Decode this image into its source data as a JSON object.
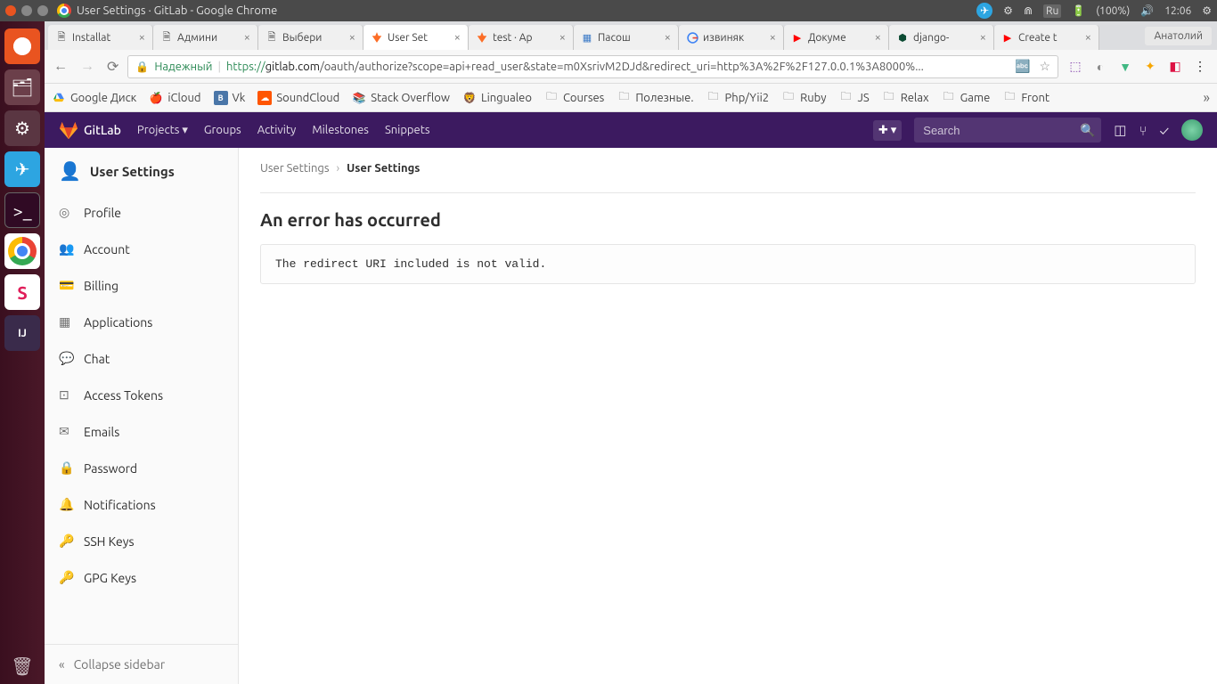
{
  "window_title": "User Settings · GitLab - Google Chrome",
  "topbar": {
    "lang": "Ru",
    "battery": "(100%)",
    "time": "12:06"
  },
  "profile_name": "Анатолий",
  "tabs": [
    {
      "title": "Installat",
      "icon": "doc"
    },
    {
      "title": "Админи",
      "icon": "doc"
    },
    {
      "title": "Выбери",
      "icon": "doc"
    },
    {
      "title": "User Set",
      "icon": "gitlab",
      "active": true
    },
    {
      "title": "test · Ap",
      "icon": "gitlab"
    },
    {
      "title": "Пасош",
      "icon": "doc-blue"
    },
    {
      "title": "извиняк",
      "icon": "google"
    },
    {
      "title": "Докуме",
      "icon": "youtube"
    },
    {
      "title": "django-",
      "icon": "django"
    },
    {
      "title": "Create t",
      "icon": "youtube"
    }
  ],
  "address": {
    "secure_label": "Надежный",
    "url_prefix": "https://",
    "url_domain": "gitlab.com",
    "url_path": "/oauth/authorize?scope=api+read_user&state=m0XsrivM2DJd&redirect_uri=http%3A%2F%2F127.0.0.1%3A8000%..."
  },
  "bookmarks": [
    {
      "label": "Google Диск",
      "icon": "gdrive"
    },
    {
      "label": "iCloud",
      "icon": "apple"
    },
    {
      "label": "Vk",
      "icon": "vk"
    },
    {
      "label": "SoundCloud",
      "icon": "sc"
    },
    {
      "label": "Stack Overflow",
      "icon": "so"
    },
    {
      "label": "Lingualeo",
      "icon": "leo"
    },
    {
      "label": "Courses",
      "icon": "folder"
    },
    {
      "label": "Полезные.",
      "icon": "folder"
    },
    {
      "label": "Php/Yii2",
      "icon": "folder"
    },
    {
      "label": "Ruby",
      "icon": "folder"
    },
    {
      "label": "JS",
      "icon": "folder"
    },
    {
      "label": "Relax",
      "icon": "folder"
    },
    {
      "label": "Game",
      "icon": "folder"
    },
    {
      "label": "Front",
      "icon": "folder"
    }
  ],
  "gitlab": {
    "brand": "GitLab",
    "nav": {
      "projects": "Projects",
      "groups": "Groups",
      "activity": "Activity",
      "milestones": "Milestones",
      "snippets": "Snippets"
    },
    "search_placeholder": "Search",
    "sidebar": {
      "title": "User Settings",
      "items": [
        {
          "label": "Profile",
          "icon": "profile"
        },
        {
          "label": "Account",
          "icon": "account"
        },
        {
          "label": "Billing",
          "icon": "billing"
        },
        {
          "label": "Applications",
          "icon": "apps"
        },
        {
          "label": "Chat",
          "icon": "chat"
        },
        {
          "label": "Access Tokens",
          "icon": "token"
        },
        {
          "label": "Emails",
          "icon": "email"
        },
        {
          "label": "Password",
          "icon": "lock"
        },
        {
          "label": "Notifications",
          "icon": "bell"
        },
        {
          "label": "SSH Keys",
          "icon": "key"
        },
        {
          "label": "GPG Keys",
          "icon": "key"
        }
      ],
      "collapse": "Collapse sidebar"
    },
    "breadcrumb": {
      "parent": "User Settings",
      "current": "User Settings"
    },
    "error": {
      "heading": "An error has occurred",
      "message": "The redirect URI included is not valid."
    }
  }
}
